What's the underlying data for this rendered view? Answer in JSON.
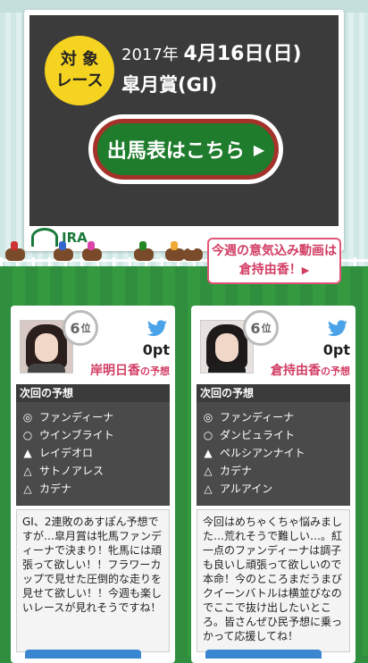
{
  "banner": {
    "badge_line1": "対 象",
    "badge_line2": "レース",
    "date_year": "2017年",
    "date_md": "4月16日",
    "date_dow": "(日)",
    "race_name": "皐月賞(GI)",
    "entry_button_label": "出馬表はこちら",
    "logo_text": "JRA",
    "video_link_line1": "今週の意気込み動画は",
    "video_link_line2": "倉持由香！"
  },
  "colors": {
    "accent_pink": "#d23d63",
    "turf_green": "#2f8f3f",
    "badge_yellow": "#f5d321",
    "board_dark": "#3b3b3b"
  },
  "panels": [
    {
      "rank": "6",
      "rank_suffix": "位",
      "points": "0pt",
      "name": "岸明日香",
      "name_suffix": "の予想",
      "prediction_header": "次回の予想",
      "picks": [
        {
          "mark": "◎",
          "horse": "ファンディーナ"
        },
        {
          "mark": "○",
          "horse": "ウインブライト"
        },
        {
          "mark": "▲",
          "horse": "レイデオロ"
        },
        {
          "mark": "△",
          "horse": "サトノアレス"
        },
        {
          "mark": "△",
          "horse": "カデナ"
        }
      ],
      "comment": "GI、2連敗のあすぽん予想ですが…皐月賞は牝馬ファンディーナで決まり！牝馬には頑張って欲しい！！フラワーカップで見せた圧倒的な走りを見せて欲しい！！今週も楽しいレースが見れそうですね！"
    },
    {
      "rank": "6",
      "rank_suffix": "位",
      "points": "0pt",
      "name": "倉持由香",
      "name_suffix": "の予想",
      "prediction_header": "次回の予想",
      "picks": [
        {
          "mark": "◎",
          "horse": "ファンディーナ"
        },
        {
          "mark": "○",
          "horse": "ダンビュライト"
        },
        {
          "mark": "▲",
          "horse": "ペルシアンナイト"
        },
        {
          "mark": "△",
          "horse": "カデナ"
        },
        {
          "mark": "△",
          "horse": "アルアイン"
        }
      ],
      "comment": "今回はめちゃくちゃ悩みました…荒れそうで難しい…。紅一点のファンディーナは調子も良いし頑張って欲しいので本命！今のところまだうまびクイーンバトルは横並びなのでここで抜け出したいところ。皆さんぜひ民予想に乗っかって応援してね！"
    }
  ]
}
